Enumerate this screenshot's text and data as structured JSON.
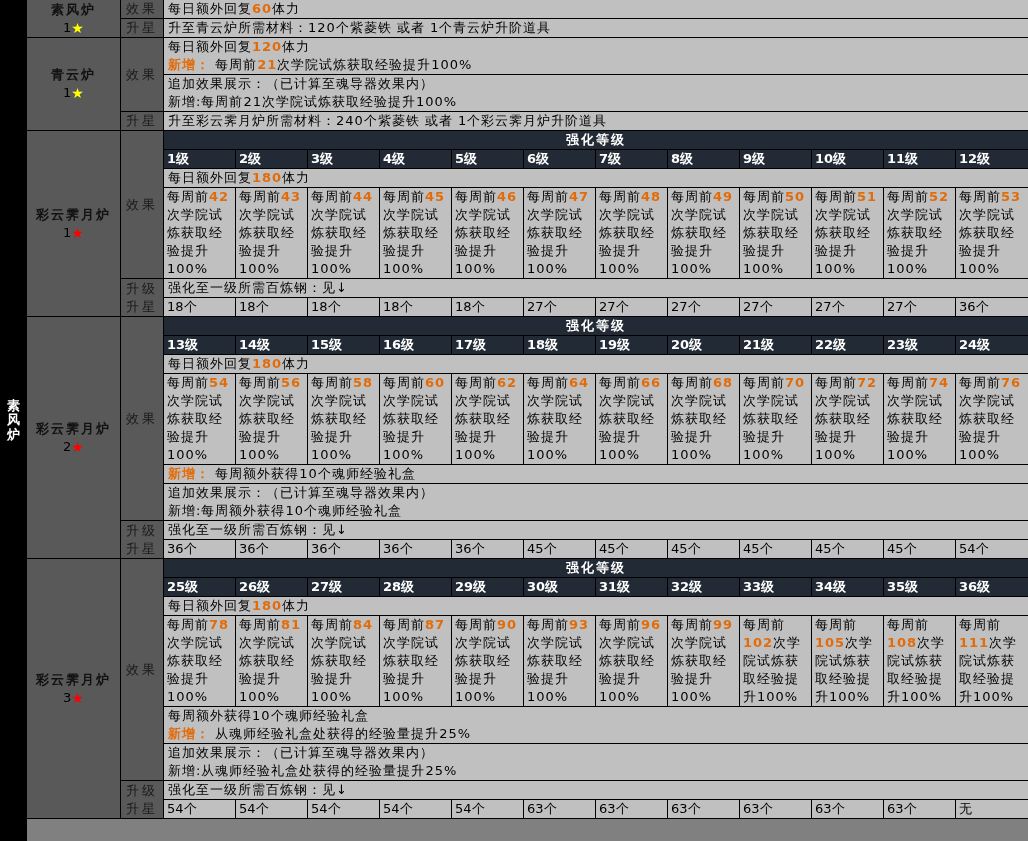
{
  "furnace_label": "素风炉",
  "tiers": [
    {
      "kind": "simple",
      "name": "素风炉",
      "rank": "1",
      "star": "★",
      "color": "#ffff00",
      "effect_label": "效果",
      "blocks": [
        [
          "每日额外回复**60**体力"
        ]
      ],
      "upgrade_label": [
        "升星"
      ],
      "upgrade_text": "升至青云炉所需材料：120个紫菱铁  或者  1个青云炉升阶道具"
    },
    {
      "kind": "simple",
      "name": "青云炉",
      "rank": "1",
      "star": "★",
      "color": "#ffff00",
      "effect_label": "效果",
      "blocks": [
        [
          "每日额外回复**120**体力",
          "**新增：** 每周前**21**次学院试炼获取经验提升100%"
        ],
        [
          "追加效果展示：（已计算至魂导器效果内）",
          "新增:每周前21次学院试炼获取经验提升100%"
        ]
      ],
      "upgrade_label": [
        "升星"
      ],
      "upgrade_text": "升至彩云霁月炉所需材料：240个紫菱铁  或者  1个彩云霁月炉升阶道具"
    },
    {
      "kind": "leveled",
      "name": "彩云霁月炉",
      "rank": "1",
      "star": "★",
      "color": "#ff0000",
      "effect_label": "效果",
      "level_header": "强化等级",
      "levels": [
        "1级",
        "2级",
        "3级",
        "4级",
        "5级",
        "6级",
        "7级",
        "8级",
        "9级",
        "10级",
        "11级",
        "12级"
      ],
      "base_line": "每日额外回复**180**体力",
      "level_effects": [
        "每周前**42**次学院试炼获取经验提升100%",
        "每周前**43**次学院试炼获取经验提升100%",
        "每周前**44**次学院试炼获取经验提升100%",
        "每周前**45**次学院试炼获取经验提升100%",
        "每周前**46**次学院试炼获取经验提升100%",
        "每周前**47**次学院试炼获取经验提升100%",
        "每周前**48**次学院试炼获取经验提升100%",
        "每周前**49**次学院试炼获取经验提升100%",
        "每周前**50**次学院试炼获取经验提升100%",
        "每周前**51**次学院试炼获取经验提升100%",
        "每周前**52**次学院试炼获取经验提升100%",
        "每周前**53**次学院试炼获取经验提升100%"
      ],
      "upgrade_label": [
        "升级",
        "升星"
      ],
      "upgrade_note": "强化至一级所需百炼钢：见↓",
      "costs": [
        "18个",
        "18个",
        "18个",
        "18个",
        "18个",
        "27个",
        "27个",
        "27个",
        "27个",
        "27个",
        "27个",
        "36个"
      ]
    },
    {
      "kind": "leveled",
      "name": "彩云霁月炉",
      "rank": "2",
      "star": "★",
      "color": "#ff0000",
      "effect_label": "效果",
      "level_header": "强化等级",
      "levels": [
        "13级",
        "14级",
        "15级",
        "16级",
        "17级",
        "18级",
        "19级",
        "20级",
        "21级",
        "22级",
        "23级",
        "24级"
      ],
      "base_line": "每日额外回复**180**体力",
      "level_effects": [
        "每周前**54**次学院试炼获取经验提升100%",
        "每周前**56**次学院试炼获取经验提升100%",
        "每周前**58**次学院试炼获取经验提升100%",
        "每周前**60**次学院试炼获取经验提升100%",
        "每周前**62**次学院试炼获取经验提升100%",
        "每周前**64**次学院试炼获取经验提升100%",
        "每周前**66**次学院试炼获取经验提升100%",
        "每周前**68**次学院试炼获取经验提升100%",
        "每周前**70**次学院试炼获取经验提升100%",
        "每周前**72**次学院试炼获取经验提升100%",
        "每周前**74**次学院试炼获取经验提升100%",
        "每周前**76**次学院试炼获取经验提升100%"
      ],
      "blocks": [
        [
          "**新增：** 每周额外获得10个魂师经验礼盒"
        ],
        [
          "追加效果展示：（已计算至魂导器效果内）",
          "新增:每周额外获得10个魂师经验礼盒"
        ]
      ],
      "upgrade_label": [
        "升级",
        "升星"
      ],
      "upgrade_note": "强化至一级所需百炼钢：见↓",
      "costs": [
        "36个",
        "36个",
        "36个",
        "36个",
        "36个",
        "45个",
        "45个",
        "45个",
        "45个",
        "45个",
        "45个",
        "54个"
      ]
    },
    {
      "kind": "leveled",
      "name": "彩云霁月炉",
      "rank": "3",
      "star": "★",
      "color": "#ff0000",
      "effect_label": "效果",
      "level_header": "强化等级",
      "levels": [
        "25级",
        "26级",
        "27级",
        "28级",
        "29级",
        "30级",
        "31级",
        "32级",
        "33级",
        "34级",
        "35级",
        "36级"
      ],
      "base_line": "每日额外回复**180**体力",
      "level_effects": [
        "每周前**78**次学院试炼获取经验提升100%",
        "每周前**81**次学院试炼获取经验提升100%",
        "每周前**84**次学院试炼获取经验提升100%",
        "每周前**87**次学院试炼获取经验提升100%",
        "每周前**90**次学院试炼获取经验提升100%",
        "每周前**93**次学院试炼获取经验提升100%",
        "每周前**96**次学院试炼获取经验提升100%",
        "每周前**99**次学院试炼获取经验提升100%",
        "每周前**102**次学院试炼获取经验提升100%",
        "每周前**105**次学院试炼获取经验提升100%",
        "每周前**108**次学院试炼获取经验提升100%",
        "每周前**111**次学院试炼获取经验提升100%"
      ],
      "blocks": [
        [
          "每周额外获得10个魂师经验礼盒",
          "**新增：** 从魂师经验礼盒处获得的经验量提升25%"
        ],
        [
          "追加效果展示：（已计算至魂导器效果内）",
          "新增:从魂师经验礼盒处获得的经验量提升25%"
        ]
      ],
      "upgrade_label": [
        "升级",
        "升星"
      ],
      "upgrade_note": "强化至一级所需百炼钢：见↓",
      "costs": [
        "54个",
        "54个",
        "54个",
        "54个",
        "54个",
        "63个",
        "63个",
        "63个",
        "63个",
        "63个",
        "63个",
        "无"
      ]
    }
  ]
}
